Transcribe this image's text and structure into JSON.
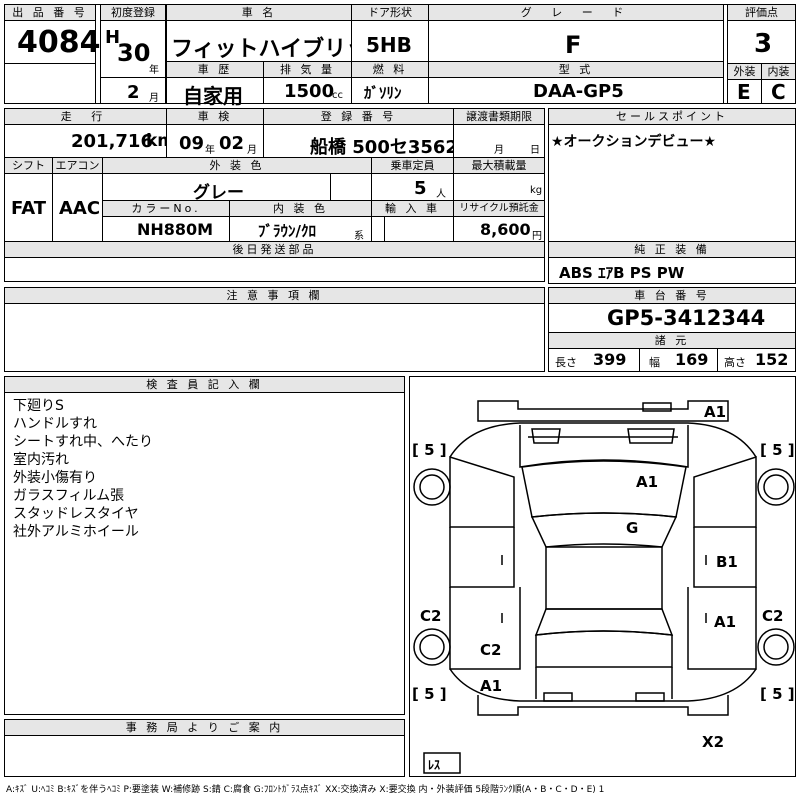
{
  "header": {
    "lot_label": "出 品 番 号",
    "lot_no": "4084",
    "first_reg_label": "初度登録",
    "era": "H",
    "year": "30",
    "year_unit": "年",
    "month": "2",
    "month_unit": "月",
    "car_name_label": "車 名",
    "car_name": "フィットハイブリッド",
    "door_label": "ドア形状",
    "door": "5HB",
    "grade_label": "グ レ ー ド",
    "grade": "F",
    "score_label": "評価点",
    "score": "3",
    "history_label": "車 歴",
    "history": "自家用",
    "displacement_label": "排 気 量",
    "displacement": "1500",
    "displacement_unit": "cc",
    "fuel_label": "燃 料",
    "fuel": "ｶﾞｿﾘﾝ",
    "model_label": "型 式",
    "model": "DAA-GP5",
    "exterior_label": "外装",
    "exterior_score": "E",
    "interior_label": "内装",
    "interior_score": "C"
  },
  "row2": {
    "mileage_label": "走 行",
    "mileage": "201,716",
    "mileage_unit": "km",
    "inspection_label": "車 検",
    "insp_year": "09",
    "insp_year_unit": "年",
    "insp_month": "02",
    "insp_month_unit": "月",
    "plate_label": "登 録 番 号",
    "plate": "船橋 500セ3562",
    "transfer_label": "譲渡書類期限",
    "transfer_month_unit": "月",
    "transfer_day_unit": "日",
    "sales_point_label": "セールスポイント",
    "sales_point": "★オークションデビュー★"
  },
  "row3": {
    "shift_label": "シフト",
    "shift": "FAT",
    "ac_label": "エアコン",
    "ac": "AAC",
    "ext_color_label": "外 装 色",
    "ext_color": "グレー",
    "capacity_label": "乗車定員",
    "capacity": "5",
    "capacity_unit": "人",
    "max_load_label": "最大積載量",
    "max_load_unit": "kg",
    "color_no_label": "カラーNo.",
    "color_no": "NH880M",
    "int_color_label": "内 装 色",
    "int_color": "ﾌﾞﾗｳﾝ/ｸﾛ",
    "int_color_suffix": "系",
    "import_label": "輸 入 車",
    "recycle_label": "リサイクル預託金",
    "recycle": "8,600",
    "recycle_unit": "円"
  },
  "later_parts_label": "後日発送部品",
  "genuine_label": "純 正 装 備",
  "genuine": "ABS ｴｱB PS PW",
  "caution_label": "注 意 事 項 欄",
  "chassis_label": "車 台 番 号",
  "chassis": "GP5-3412344",
  "specs_label": "諸 元",
  "specs": {
    "length_label": "長さ",
    "length": "399",
    "width_label": "幅",
    "width": "169",
    "height_label": "高さ",
    "height": "152"
  },
  "inspector_label": "検 査 員 記 入 欄",
  "inspector_notes": [
    "下廻りS",
    "ハンドルすれ",
    "シートすれ中、へたり",
    "室内汚れ",
    "外装小傷有り",
    "ガラスフィルム張",
    "スタッドレスタイヤ",
    "社外アルミホイール"
  ],
  "office_label": "事 務 局 よ り ご 案 内",
  "diagram_marks": {
    "front_bumper": "A1",
    "hood": "A1",
    "roof": "G",
    "right_rear_door": "B1",
    "right_rear_fender": "A1",
    "right_quarter": "C2",
    "left_rocker": "C2",
    "left_front_fender_rear": "C2",
    "left_front": "A1",
    "rear_bumper": "X2"
  },
  "tire_marks": {
    "front_left": "5",
    "front_right": "5",
    "rear_left": "5",
    "rear_right": "5",
    "spare": "ﾚｽ"
  },
  "legend": "A:ｷｽﾞ U:ﾍｺﾐ B:ｷｽﾞを伴うﾍｺﾐ P:要塗装 W:補修跡 S:錆 C:腐食 G:ﾌﾛﾝﾄｶﾞﾗｽ点ｷｽﾞ XX:交換済み X:要交換 内・外装評価 5段階ﾗﾝｸ順(A・B・C・D・E) 1"
}
